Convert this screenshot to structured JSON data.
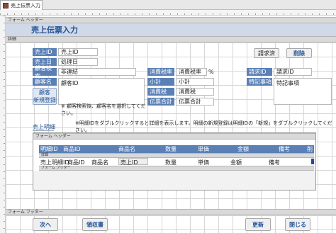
{
  "tab": {
    "title": "売上伝票入力"
  },
  "sections": {
    "form_header": "フォーム ヘッダー",
    "detail": "詳細",
    "form_footer": "フォーム フッター",
    "sub_form_header": "フォーム ヘッダー",
    "sub_detail": "詳細",
    "sub_form_footer": "フォーム フッター"
  },
  "header": {
    "title": "売上伝票入力"
  },
  "fields": {
    "sales_id": {
      "label": "売上ID",
      "value": "売上ID"
    },
    "sales_date": {
      "label": "売上日",
      "value": "処理日"
    },
    "customer_search": {
      "label": "顧客検索",
      "value": "非連結"
    },
    "customer_name": {
      "label": "顧客名",
      "value": "顧客ID"
    },
    "tax_rate": {
      "label": "消費税率",
      "value": "消費税率",
      "unit": "%"
    },
    "subtotal": {
      "label": "小計",
      "value": "小計"
    },
    "tax": {
      "label": "消費税",
      "value": "消費税"
    },
    "total": {
      "label": "伝票合計",
      "value": "伝票合計"
    },
    "request_id": {
      "label": "請求ID",
      "value": "請求ID"
    },
    "special_notes": {
      "label": "特記事項",
      "value": "特記事項"
    }
  },
  "buttons": {
    "billed": "請求済",
    "delete": "削除",
    "register_customer_line1": "顧客",
    "register_customer_line2": "新規登録",
    "next": "次へ",
    "receipt": "領収書",
    "update": "更新",
    "close": "閉じる"
  },
  "notes": {
    "customer_search_note": "※ 顧客検索後、顧客名を選択してください。",
    "detail_note": "※明細IDをダブルクリックすると詳細を表示します。明細の新規登録は明細IDの「新規」をダブルクリックしてください。"
  },
  "detail_section": {
    "label": "売上明細"
  },
  "subform": {
    "columns": [
      "明細ID",
      "商品ID",
      "商品名",
      "数量",
      "単価",
      "金額",
      "備考",
      "削"
    ],
    "row": [
      "売上明細ID",
      "商品ID",
      "商品名",
      "売上ID",
      "数量",
      "単価",
      "金額",
      "備考"
    ]
  },
  "colors": {
    "accent": "#5a80b6",
    "title_text": "#1f4f95"
  }
}
